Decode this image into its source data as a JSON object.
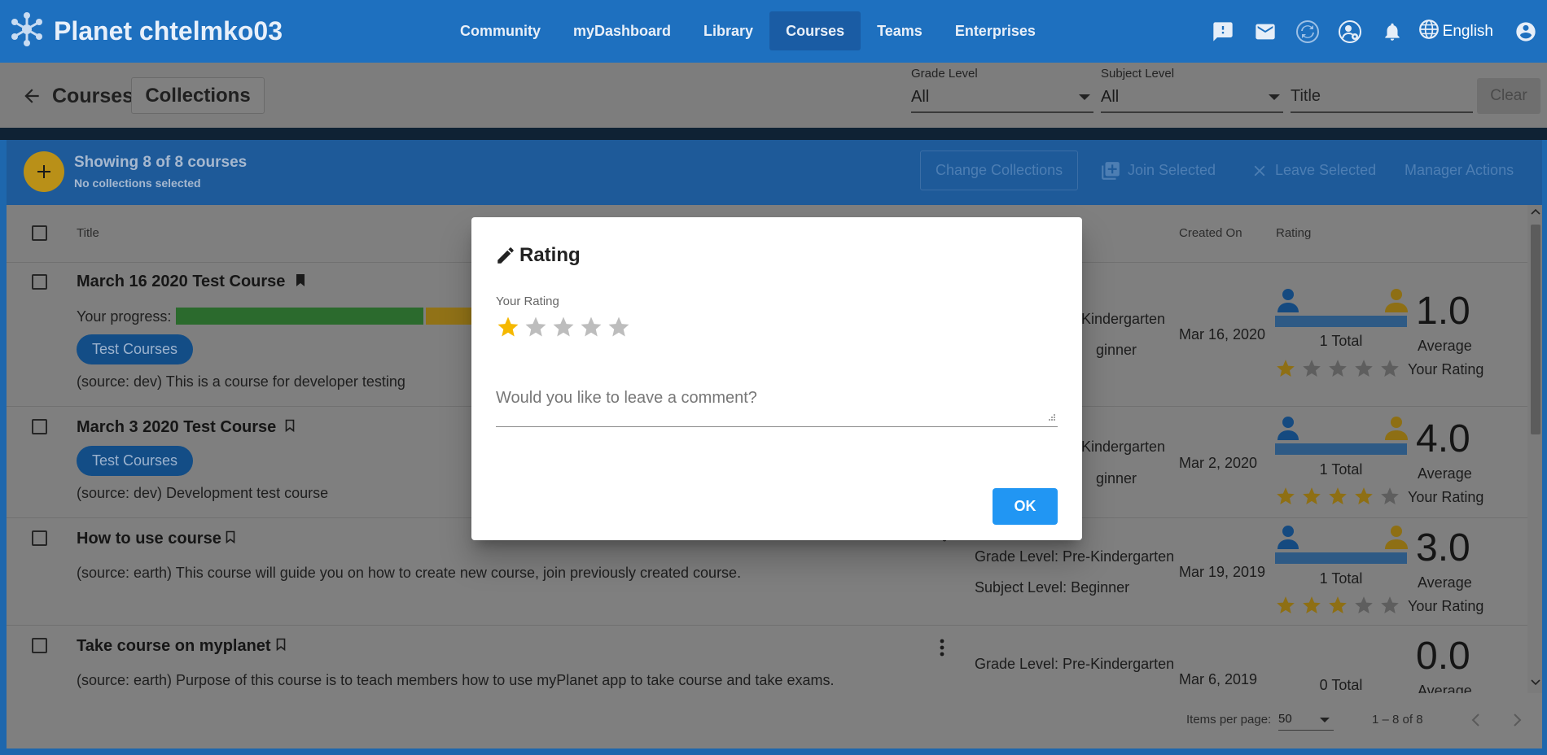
{
  "app": {
    "title": "Planet chtelmko03"
  },
  "nav": [
    "Community",
    "myDashboard",
    "Library",
    "Courses",
    "Teams",
    "Enterprises"
  ],
  "nav_active": "Courses",
  "topbar": {
    "language": "English"
  },
  "header": {
    "page_title": "Courses",
    "collections_label": "Collections"
  },
  "filters": {
    "grade_label": "Grade Level",
    "grade_value": "All",
    "subject_label": "Subject Level",
    "subject_value": "All",
    "title_placeholder": "Title",
    "clear_label": "Clear"
  },
  "toolbar": {
    "showing": "Showing 8 of 8 courses",
    "collections_status": "No collections selected",
    "change_collections": "Change Collections",
    "join_selected": "Join Selected",
    "leave_selected": "Leave Selected",
    "manager_actions": "Manager Actions"
  },
  "table": {
    "headers": {
      "title": "Title",
      "created_on": "Created On",
      "rating": "Rating"
    },
    "rows": [
      {
        "title": "March 16 2020 Test Course",
        "bookmarked": true,
        "progress_label": "Your progress:",
        "tag": "Test Courses",
        "description": "(source: dev) This is a course for developer testing",
        "grade": "Kindergarten",
        "subject": "ginner",
        "created": "Mar 16, 2020",
        "rating": "1.0",
        "total": "1 Total",
        "average_label": "Average",
        "your_rating_label": "Your Rating",
        "stars": 1
      },
      {
        "title": "March 3 2020 Test Course",
        "bookmarked": false,
        "tag": "Test Courses",
        "description": "(source: dev) Development test course",
        "grade": "Kindergarten",
        "subject": "ginner",
        "created": "Mar 2, 2020",
        "rating": "4.0",
        "total": "1 Total",
        "average_label": "Average",
        "your_rating_label": "Your Rating",
        "stars": 4
      },
      {
        "title": "How to use course",
        "bookmarked": false,
        "description": "(source: earth) This course will guide you on how to create new course, join previously created course.",
        "grade": "Grade Level: Pre-Kindergarten",
        "subject": "Subject Level: Beginner",
        "created": "Mar 19, 2019",
        "rating": "3.0",
        "total": "1 Total",
        "average_label": "Average",
        "your_rating_label": "Your Rating",
        "stars": 3
      },
      {
        "title": "Take course on myplanet",
        "bookmarked": false,
        "description": "(source: earth) Purpose of this course is to teach members how to use myPlanet app to take course and take exams.",
        "grade": "Grade Level: Pre-Kindergarten",
        "created": "Mar 6, 2019",
        "rating": "0.0",
        "total": "0 Total",
        "average_label": "Average"
      }
    ]
  },
  "paginator": {
    "items_per_page_label": "Items per page:",
    "page_size": "50",
    "range": "1 – 8 of 8"
  },
  "dialog": {
    "title": "Rating",
    "your_rating_label": "Your Rating",
    "selected_stars": 1,
    "max_stars": 5,
    "comment_placeholder": "Would you like to leave a comment?",
    "ok_label": "OK"
  },
  "colors": {
    "primary": "#1e70bf",
    "accent": "#f5b800",
    "ok_button": "#2196f3",
    "progress_green": "#4caf50",
    "progress_amber": "#f5b800"
  }
}
